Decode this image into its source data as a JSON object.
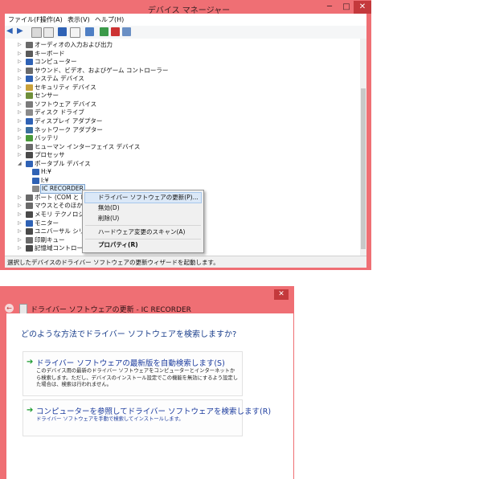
{
  "device_manager": {
    "title": "デバイス マネージャー",
    "window_controls": {
      "minimize": "─",
      "maximize": "□",
      "close": "✕"
    },
    "menu": [
      "ファイル(F)",
      "操作(A)",
      "表示(V)",
      "ヘルプ(H)"
    ],
    "toolbar_icons": [
      "back-icon",
      "forward-icon",
      "view-icon",
      "properties-icon",
      "help-icon",
      "show-hidden-icon",
      "monitor-icon",
      "update-driver-icon",
      "disable-device-icon",
      "scan-hardware-icon"
    ],
    "tree": [
      {
        "label": "オーディオの入力および出力",
        "expander": "▷",
        "icon": "speaker-icon",
        "color": "#6a6a6a"
      },
      {
        "label": "キーボード",
        "expander": "▷",
        "icon": "keyboard-icon",
        "color": "#5a5a5a"
      },
      {
        "label": "コンピューター",
        "expander": "▷",
        "icon": "computer-icon",
        "color": "#2f62b5"
      },
      {
        "label": "サウンド、ビデオ、およびゲーム コントローラー",
        "expander": "▷",
        "icon": "sound-icon",
        "color": "#6a6a6a"
      },
      {
        "label": "システム デバイス",
        "expander": "▷",
        "icon": "system-icon",
        "color": "#2f62b5"
      },
      {
        "label": "セキュリティ デバイス",
        "expander": "▷",
        "icon": "security-icon",
        "color": "#c9a13a"
      },
      {
        "label": "センサー",
        "expander": "▷",
        "icon": "sensor-icon",
        "color": "#6f8f3a"
      },
      {
        "label": "ソフトウェア デバイス",
        "expander": "▷",
        "icon": "software-icon",
        "color": "#7a7a7a"
      },
      {
        "label": "ディスク ドライブ",
        "expander": "▷",
        "icon": "disk-icon",
        "color": "#8a8a8a"
      },
      {
        "label": "ディスプレイ アダプター",
        "expander": "▷",
        "icon": "display-icon",
        "color": "#2f62b5"
      },
      {
        "label": "ネットワーク アダプター",
        "expander": "▷",
        "icon": "network-icon",
        "color": "#3a6f9f"
      },
      {
        "label": "バッテリ",
        "expander": "▷",
        "icon": "battery-icon",
        "color": "#4a9a3a"
      },
      {
        "label": "ヒューマン インターフェイス デバイス",
        "expander": "▷",
        "icon": "hid-icon",
        "color": "#6a6a6a"
      },
      {
        "label": "プロセッサ",
        "expander": "▷",
        "icon": "processor-icon",
        "color": "#4a4a4a"
      },
      {
        "label": "ポータブル デバイス",
        "expander": "◢",
        "icon": "portable-icon",
        "color": "#2f62b5"
      },
      {
        "label": "H:¥",
        "expander": "",
        "icon": "drive-icon",
        "color": "#2f62b5",
        "child": true
      },
      {
        "label": "I:¥",
        "expander": "",
        "icon": "drive-icon",
        "color": "#2f62b5",
        "child": true
      },
      {
        "label": "IC RECORDER",
        "expander": "",
        "icon": "recorder-icon",
        "color": "#8a8a8a",
        "child": true,
        "selected": true
      },
      {
        "label": "ポート (COM と LPT",
        "expander": "▷",
        "icon": "port-icon",
        "color": "#6a6a6a"
      },
      {
        "label": "マウスとそのほかのポイ",
        "expander": "▷",
        "icon": "mouse-icon",
        "color": "#6a6a6a"
      },
      {
        "label": "メモリ テクノロジ デバイ",
        "expander": "▷",
        "icon": "memory-icon",
        "color": "#4a4a4a"
      },
      {
        "label": "モニター",
        "expander": "▷",
        "icon": "monitor-icon",
        "color": "#2f62b5"
      },
      {
        "label": "ユニバーサル シリアル",
        "expander": "▷",
        "icon": "usb-icon",
        "color": "#4a4a4a"
      },
      {
        "label": "印刷キュー",
        "expander": "▷",
        "icon": "printer-icon",
        "color": "#6a6a6a"
      },
      {
        "label": "記憶域コントローラー",
        "expander": "▷",
        "icon": "storage-icon",
        "color": "#4a4a4a"
      }
    ],
    "context_menu": [
      "ドライバー ソフトウェアの更新(P)...",
      "無効(D)",
      "削除(U)",
      "ハードウェア変更のスキャン(A)",
      "プロパティ(R)"
    ],
    "status": "選択したデバイスのドライバー ソフトウェアの更新ウィザードを起動します。"
  },
  "wizard": {
    "close": "✕",
    "back": "←",
    "title": "ドライバー ソフトウェアの更新 - IC RECORDER",
    "question": "どのような方法でドライバー ソフトウェアを検索しますか?",
    "option1": {
      "arrow": "➔",
      "title": "ドライバー ソフトウェアの最新版を自動検索します(S)",
      "desc": "このデバイス用の最新のドライバー ソフトウェアをコンピューターとインターネットから検索します。ただし、デバイスのインストール設定でこの機能を無効にするよう設定した場合は、検索は行われません。"
    },
    "option2": {
      "arrow": "➔",
      "title": "コンピューターを参照してドライバー ソフトウェアを検索します(R)",
      "desc": "ドライバー ソフトウェアを手動で検索してインストールします。"
    }
  },
  "colors": {
    "accent": "#ef6f74",
    "close": "#c4393c",
    "link": "#1c3c9e"
  }
}
